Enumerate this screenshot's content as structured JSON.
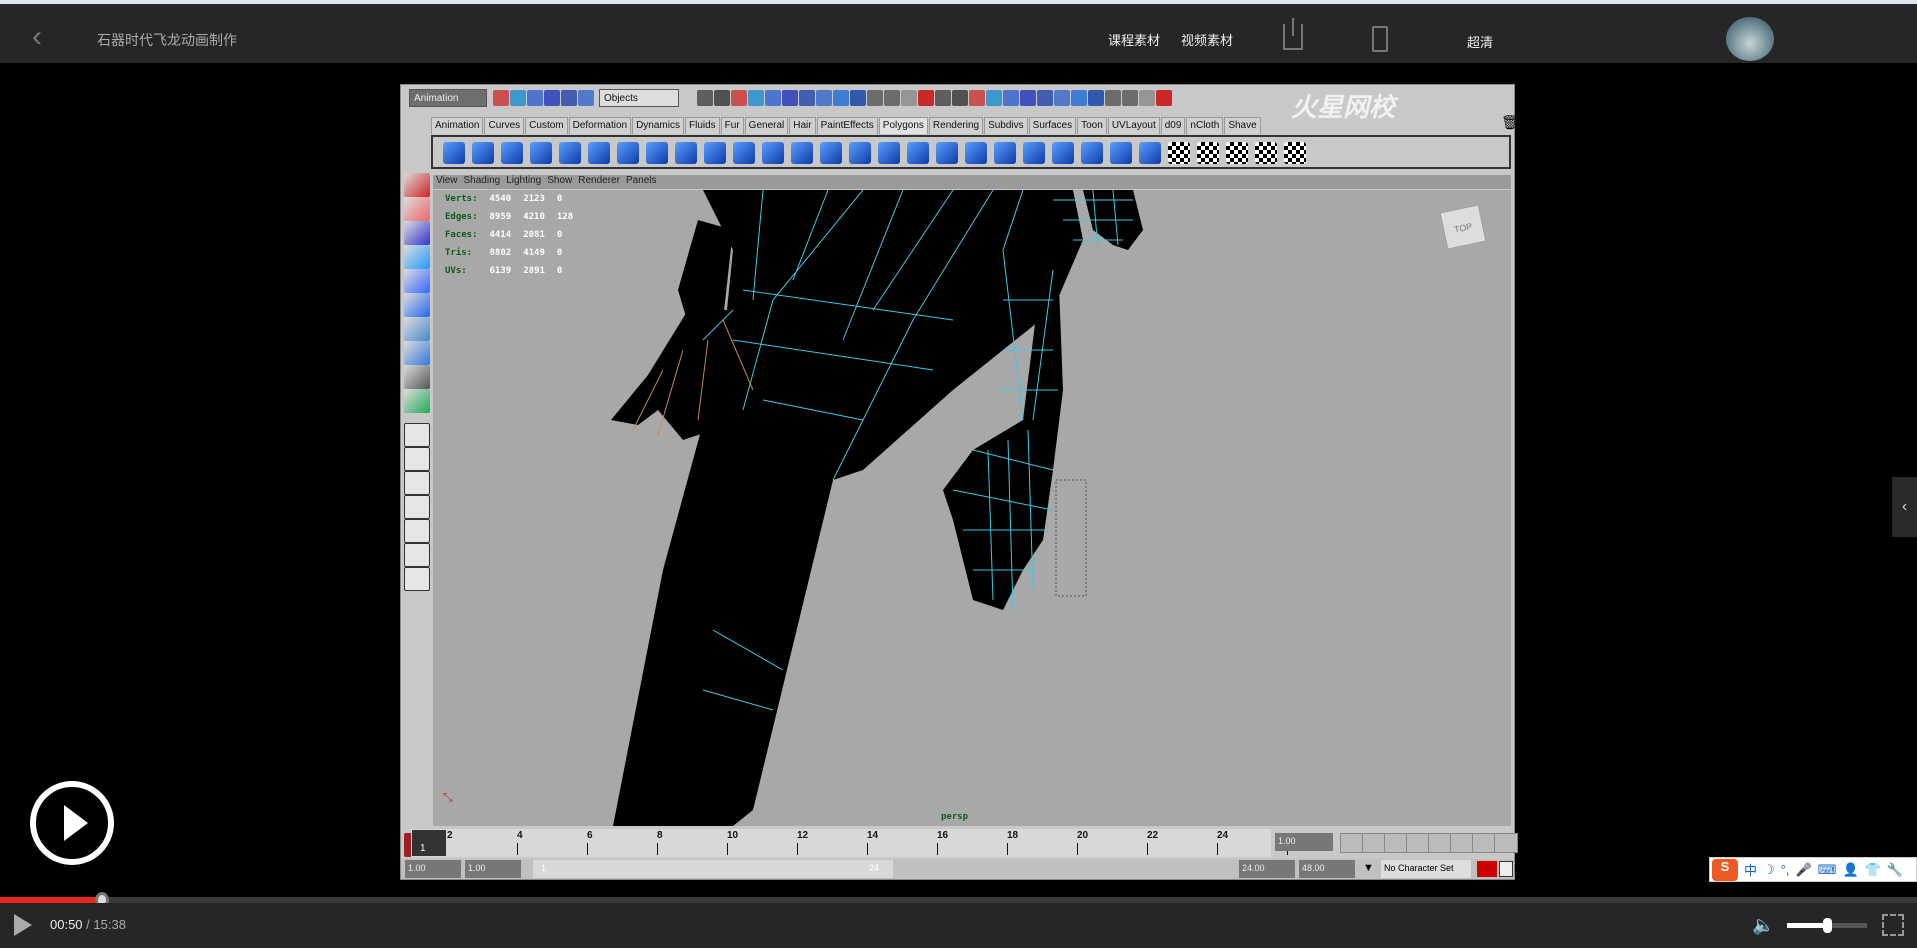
{
  "header": {
    "back_icon": "chevron-left-icon",
    "title": "石器时代飞龙动画制作",
    "links": [
      "课程素材",
      "视频素材"
    ],
    "share_icon": "share-icon",
    "mobile_icon": "phone-icon",
    "quality": "超清",
    "avatar": "user-avatar"
  },
  "maya": {
    "mode_menu": "Animation",
    "selection_field": "Objects",
    "shelf_tabs": [
      "Animation",
      "Curves",
      "Custom",
      "Deformation",
      "Dynamics",
      "Fluids",
      "Fur",
      "General",
      "Hair",
      "PaintEffects",
      "Polygons",
      "Rendering",
      "Subdivs",
      "Surfaces",
      "Toon",
      "UVLayout",
      "d09",
      "nCloth",
      "Shave"
    ],
    "active_tab": "Polygons",
    "panel_menu": [
      "View",
      "Shading",
      "Lighting",
      "Show",
      "Renderer",
      "Panels"
    ],
    "hud": [
      {
        "label": "Verts:",
        "v": [
          "4540",
          "2123",
          "0"
        ]
      },
      {
        "label": "Edges:",
        "v": [
          "8959",
          "4210",
          "128"
        ]
      },
      {
        "label": "Faces:",
        "v": [
          "4414",
          "2081",
          "0"
        ]
      },
      {
        "label": "Tris:",
        "v": [
          "8802",
          "4149",
          "0"
        ]
      },
      {
        "label": "UVs:",
        "v": [
          "6139",
          "2891",
          "0"
        ]
      }
    ],
    "camera": "persp",
    "view_cube": "TOP",
    "watermark": "火星网校 www.hxsd.cn",
    "timeline_ticks": [
      "2",
      "4",
      "6",
      "8",
      "10",
      "12",
      "14",
      "16",
      "18",
      "20",
      "22",
      "24"
    ],
    "current_frame": "1",
    "current_time_field": "1.00",
    "range": {
      "start": "1.00",
      "playback_start": "1.00",
      "slider_start": "1",
      "slider_end": "24",
      "playback_end": "24.00",
      "end": "48.00"
    },
    "character_set": "No Character Set",
    "accent": "#3fc8e6"
  },
  "ime": {
    "logo": "S",
    "items": [
      "中",
      "☽",
      "°,",
      "🎤",
      "⌨",
      "👤",
      "👕",
      "🔧"
    ]
  },
  "player": {
    "current": "00:50",
    "separator": " / ",
    "duration": "15:38",
    "progress_percent": 5.3,
    "volume_percent": 50,
    "accent": "#e8281c"
  }
}
